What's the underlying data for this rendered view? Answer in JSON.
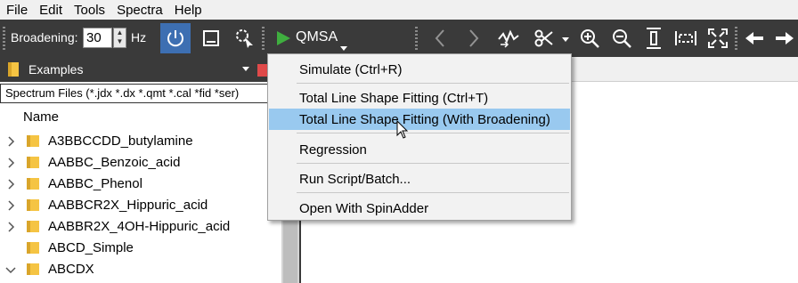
{
  "menubar": {
    "items": [
      "File",
      "Edit",
      "Tools",
      "Spectra",
      "Help"
    ]
  },
  "toolbar": {
    "broadening_label": "Broadening:",
    "broadening_value": "30",
    "broadening_unit": "Hz",
    "qmsa_label": "QMSA",
    "icons": [
      "power-icon",
      "window-icon",
      "magic-cursor-icon",
      "play-icon",
      "back-arrow-icon",
      "forward-arrow-icon",
      "spectrum-transform-icon",
      "scissors-icon",
      "zoom-in-icon",
      "zoom-out-icon",
      "fit-height-icon",
      "fit-width-icon",
      "fullscreen-icon",
      "left-arrow-icon",
      "right-arrow-icon"
    ],
    "accent": "#3d6fb2"
  },
  "left_panel": {
    "examples_label": "Examples",
    "filter": "Spectrum Files (*.jdx *.dx *.qmt *.cal *fid *ser)",
    "column_header": "Name",
    "tree": [
      {
        "name": "A3BBCCDD_butylamine",
        "expander": "collapsed"
      },
      {
        "name": "AABBC_Benzoic_acid",
        "expander": "collapsed"
      },
      {
        "name": "AABBC_Phenol",
        "expander": "collapsed"
      },
      {
        "name": "AABBCR2X_Hippuric_acid",
        "expander": "collapsed"
      },
      {
        "name": "AABBR2X_4OH-Hippuric_acid",
        "expander": "collapsed"
      },
      {
        "name": "ABCD_Simple",
        "expander": "none"
      },
      {
        "name": "ABCDX",
        "expander": "expanded"
      }
    ],
    "folder_color": "#f5c443"
  },
  "menu": {
    "items": [
      {
        "label": "Simulate (Ctrl+R)",
        "highlighted": false
      },
      {
        "label": "Total Line Shape Fitting (Ctrl+T)",
        "highlighted": false
      },
      {
        "label": "Total Line Shape Fitting (With Broadening)",
        "highlighted": true
      },
      {
        "label": "Regression",
        "highlighted": false
      },
      {
        "label": "Run Script/Batch...",
        "highlighted": false
      },
      {
        "label": "Open With SpinAdder",
        "highlighted": false
      }
    ],
    "highlight_color": "#99c9ef"
  }
}
